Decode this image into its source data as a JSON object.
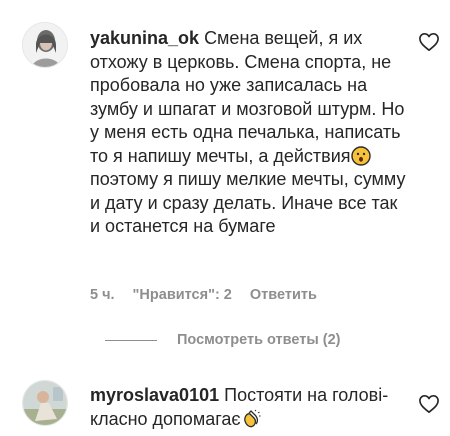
{
  "comments": [
    {
      "username": "yakunina_ok",
      "text_before_emoji": "Смена вещей, я их отхожу в церковь. Смена спорта, не пробовала но уже записалась на зумбу и шпагат и мозговой штурм. Но у меня есть одна печалька, написать то я напишу мечты, а действия",
      "emoji_icon": "hushed-face-emoji-icon",
      "text_after_emoji": " поэтому я пишу мелкие мечты, сумму и дату и сразу делать. Иначе все так и останется на бумаге",
      "time": "5 ч.",
      "likes": "\"Нравится\": 2",
      "reply": "Ответить",
      "view_replies": "Посмотреть ответы (2)"
    },
    {
      "username": "myroslava0101",
      "text_before_emoji": "Постояти на голові-класно допомагає",
      "emoji_icon": "clapping-hands-emoji-icon"
    }
  ],
  "colors": {
    "text": "#262626",
    "secondary": "#8e8e8e",
    "emoji_yellow": "#f7c23a",
    "emoji_outline": "#2b2b2b"
  },
  "icons": [
    "avatar",
    "heart-outline-icon",
    "hushed-face-emoji-icon",
    "clapping-hands-emoji-icon"
  ]
}
